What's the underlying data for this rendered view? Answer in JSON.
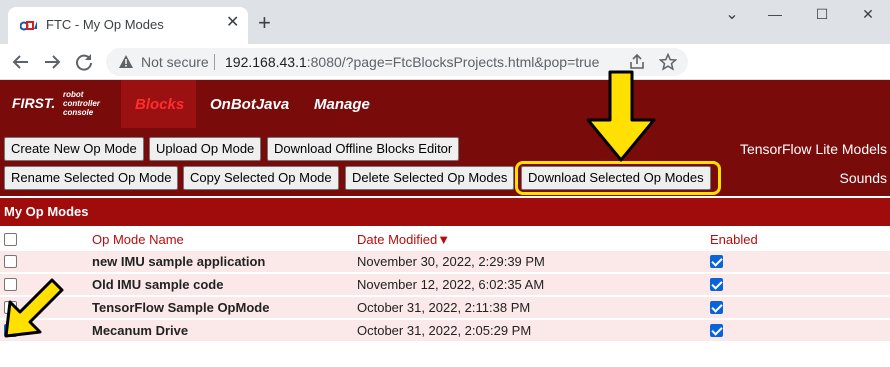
{
  "browser": {
    "tab_title": "FTC - My Op Modes",
    "close_glyph": "✕",
    "new_tab_glyph": "+",
    "window_controls": {
      "collapse": "⌄",
      "minimize": "—",
      "maximize": "☐",
      "close": "✕"
    },
    "security_label": "Not secure",
    "url_host": "192.168.43.1",
    "url_rest": ":8080/?page=FtcBlocksProjects.html&pop=true",
    "icons": [
      "back-arrow-icon",
      "forward-arrow-icon",
      "reload-icon",
      "warning-icon",
      "share-icon",
      "star-icon"
    ]
  },
  "header": {
    "logo_main": "FIRST.",
    "logo_sub_lines": [
      "robot",
      "controller",
      "console"
    ],
    "nav": {
      "blocks": "Blocks",
      "onbotjava": "OnBotJava",
      "manage": "Manage"
    },
    "accent_color": "#7a0b0b",
    "active_color": "#ff2d2d"
  },
  "toolbar": {
    "create_label": "Create New Op Mode",
    "upload_label": "Upload Op Mode",
    "download_offline_label": "Download Offline Blocks Editor",
    "rename_label": "Rename Selected Op Mode",
    "copy_label": "Copy Selected Op Mode",
    "delete_label": "Delete Selected Op Modes",
    "download_selected_label": "Download Selected Op Modes",
    "tensorflow_link": "TensorFlow Lite Models",
    "sounds_link": "Sounds"
  },
  "section": {
    "title": "My Op Modes"
  },
  "table": {
    "columns": {
      "name": "Op Mode Name",
      "date": "Date Modified",
      "sort_indicator": "▼",
      "enabled": "Enabled"
    },
    "rows": [
      {
        "name": "new IMU sample application",
        "date": "November 30, 2022, 2:29:39 PM",
        "selected": false,
        "enabled": true
      },
      {
        "name": "Old IMU sample code",
        "date": "November 12, 2022, 6:02:35 AM",
        "selected": false,
        "enabled": true
      },
      {
        "name": "TensorFlow Sample OpMode",
        "date": "October 31, 2022, 2:11:38 PM",
        "selected": false,
        "enabled": true
      },
      {
        "name": "Mecanum Drive",
        "date": "October 31, 2022, 2:05:29 PM",
        "selected": true,
        "enabled": true
      }
    ]
  },
  "annotations": {
    "color": "#ffe000"
  }
}
